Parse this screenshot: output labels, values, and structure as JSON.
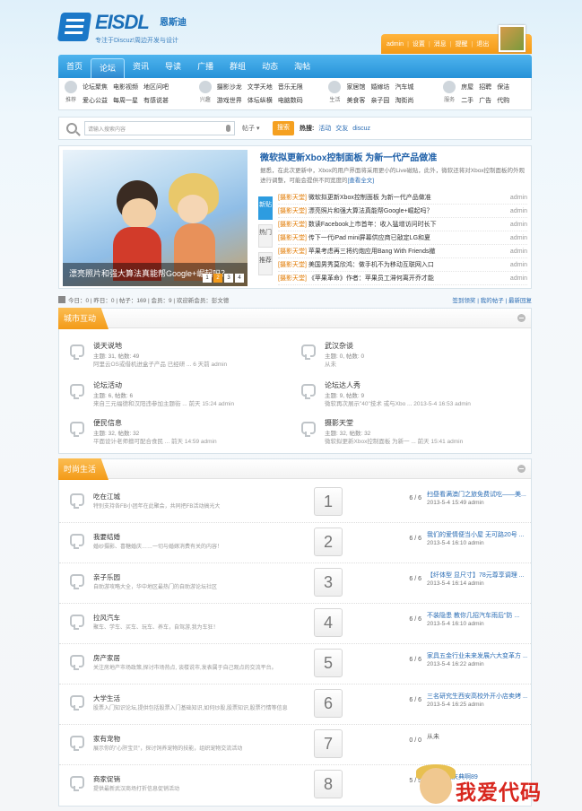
{
  "header": {
    "logo_text": "EISDL",
    "logo_cn": "恩斯迪",
    "tagline": "专注于Discuz!周边开发与设计",
    "userbar": [
      "admin",
      "|",
      "设置",
      "|",
      "消息",
      "|",
      "提醒",
      "|",
      "退出"
    ]
  },
  "nav": [
    "首页",
    "论坛",
    "资讯",
    "导读",
    "广播",
    "群组",
    "动态",
    "淘帖"
  ],
  "subnav": [
    {
      "icon_label": "推荐",
      "items": [
        "论坛聚焦",
        "电影视频",
        "地区问吧",
        "爱心公益",
        "每周一星",
        "有感说甚"
      ]
    },
    {
      "icon_label": "兴趣",
      "items": [
        "摄影沙龙",
        "文学天地",
        "音乐无限",
        "游戏世界",
        "体坛纵横",
        "电脑数码"
      ]
    },
    {
      "icon_label": "生活",
      "items": [
        "家居馆",
        "婚嫁坊",
        "汽车城",
        "美食客",
        "亲子园",
        "淘街尚"
      ]
    },
    {
      "icon_label": "服务",
      "items": [
        "房屋",
        "招聘",
        "保洁",
        "二手",
        "广告",
        "代购"
      ]
    }
  ],
  "search": {
    "placeholder": "请输入搜索内容",
    "select": "帖子",
    "button": "搜索",
    "hot_label": "热搜:",
    "hot": [
      "活动",
      "交友",
      "discuz"
    ]
  },
  "portal": {
    "slide_caption": "漂亮照片和强大算法真能帮Google+崛起吗？",
    "slide_pages": [
      "1",
      "2",
      "3",
      "4"
    ],
    "headline": "微软拟更新Xbox控制面板 为新一代产品做准",
    "summary": "据悉，在此次更新中，Xbox的用户界面将采用更小的Live磁贴，此外，微软还将对Xbox控制面板的外观进行调整，可能会提供不同宽度的",
    "summary_more": "[查看全文]",
    "tabs": [
      "新贴",
      "热门",
      "推荐"
    ],
    "list": [
      {
        "cat": "[摄影天堂]",
        "title": "微软拟更新Xbox控制面板 为新一代产品做准",
        "author": "admin"
      },
      {
        "cat": "[摄影天堂]",
        "title": "漂亮照片和强大算法真能帮Google+崛起吗？",
        "author": "admin"
      },
      {
        "cat": "[摄影天堂]",
        "title": "数读Facebook上市首年：收入猛增访问时长下",
        "author": "admin"
      },
      {
        "cat": "[摄影天堂]",
        "title": "传下一代iPad mini屏幕供应商已敲定LG和夏",
        "author": "admin"
      },
      {
        "cat": "[摄影天堂]",
        "title": "苹果考虑再三将约炮应用Bang With Friends撤",
        "author": "admin"
      },
      {
        "cat": "[摄影天堂]",
        "title": "美国男秀莫欣鸿：做手机不为移动互联网入口",
        "author": "admin"
      },
      {
        "cat": "[摄影天堂]",
        "title": "《苹果革命》作者：苹果员工滞何离开乔才能",
        "author": "admin"
      }
    ]
  },
  "stats": {
    "text": "今日：0 | 昨日：0 | 帖子：169 | 会员：9 | 欢迎新会员：彭文德",
    "right": "签到领奖 | 我的帖子 | 最新回复"
  },
  "city": {
    "title": "城市互动",
    "forums": [
      {
        "name": "谈天说地",
        "meta": "主题: 31, 帖数: 49",
        "last": "阿里云OS或借机进盒子产品 已经研 ... 6 天前 admin"
      },
      {
        "name": "武汉杂谈",
        "meta": "主题: 0, 帖数: 0",
        "last": "从未"
      },
      {
        "name": "论坛活动",
        "meta": "主题: 6, 帖数: 6",
        "last": "来自三元福德和汉阳违参加主题街 ... 前天 15:24 admin"
      },
      {
        "name": "论坛达人秀",
        "meta": "主题: 9, 帖数: 9",
        "last": "微软再次展示\"40\"技术 或与Xbo ... 2013-5-4 16:53 admin"
      },
      {
        "name": "便民信息",
        "meta": "主题: 32, 帖数: 32",
        "last": "平面设计老师擅可配合食民 ... 前天 14:59 admin"
      },
      {
        "name": "摄影天堂",
        "meta": "主题: 32, 帖数: 32",
        "last": "微软拟更新Xbox控制面板 为新一 ... 前天 15:41 admin"
      }
    ]
  },
  "fashion": {
    "title": "时尚生活",
    "forums": [
      {
        "num": "1",
        "name": "吃在江城",
        "desc": "特别支持各FB小团年在此聚会，共同把FB活动搞光大",
        "count": "6 / 6",
        "last_title": "扫昼看满澳门之旅免费试吃——美...",
        "last_meta": "2013-5-4 15:49 admin"
      },
      {
        "num": "2",
        "name": "我要结婚",
        "desc": "婚纱摄影、喜糖婚庆……一切与婚嫁消费有关的内容！",
        "count": "6 / 6",
        "last_title": "我们的爱情便当小屋 无可路20号 ...",
        "last_meta": "2013-5-4 16:10 admin"
      },
      {
        "num": "3",
        "name": "亲子乐园",
        "desc": "自助游攻略大全，华中地区最热门的自助游论坛社区",
        "count": "6 / 6",
        "last_title": "【纤体型 显尺寸】78元尊享调理 ...",
        "last_meta": "2013-5-4 16:14 admin"
      },
      {
        "num": "4",
        "name": "拉风汽车",
        "desc": "聚车、学车、买车、玩车、养车，自驾游,我为车狂！",
        "count": "6 / 6",
        "last_title": "不装隐患 教你几招汽车雨后\"防 ...",
        "last_meta": "2013-5-4 16:10 admin"
      },
      {
        "num": "5",
        "name": "房产家居",
        "desc": "关注房地产市场政策,探讨市场热点, 谈楼说市,发表属于自己观点的交流平台。",
        "count": "6 / 6",
        "last_title": "家具五金行业未来发展六大变革方 ...",
        "last_meta": "2013-5-4 16:22 admin"
      },
      {
        "num": "6",
        "name": "大学生活",
        "desc": "股票入门知识论坛,提供包括股票入门基础知识,如何炒股,股票知识,股票行情等信息",
        "count": "6 / 6",
        "last_title": "三名研究生西安高校外开小店卖烤 ...",
        "last_meta": "2013-5-4 16:25 admin"
      },
      {
        "num": "7",
        "name": "家有宠物",
        "desc": "展示你的\"心肝宝贝\"，探讨饲养宠物的技能，组织宠物交流活动",
        "count": "0 / 0",
        "last_title": "从未",
        "last_meta": ""
      },
      {
        "num": "8",
        "name": "商家促销",
        "desc": "提供最新武汉商场打折信息促销活动",
        "count": "5 / 5",
        "last_title": "百胜活动庆典啊89",
        "last_meta": "2013-5-4"
      }
    ]
  },
  "watermark": "我爱代码",
  "colors": {
    "nav_blue": "#2692d8",
    "accent_orange": "#f39a17",
    "link_blue": "#2a6cb4"
  }
}
